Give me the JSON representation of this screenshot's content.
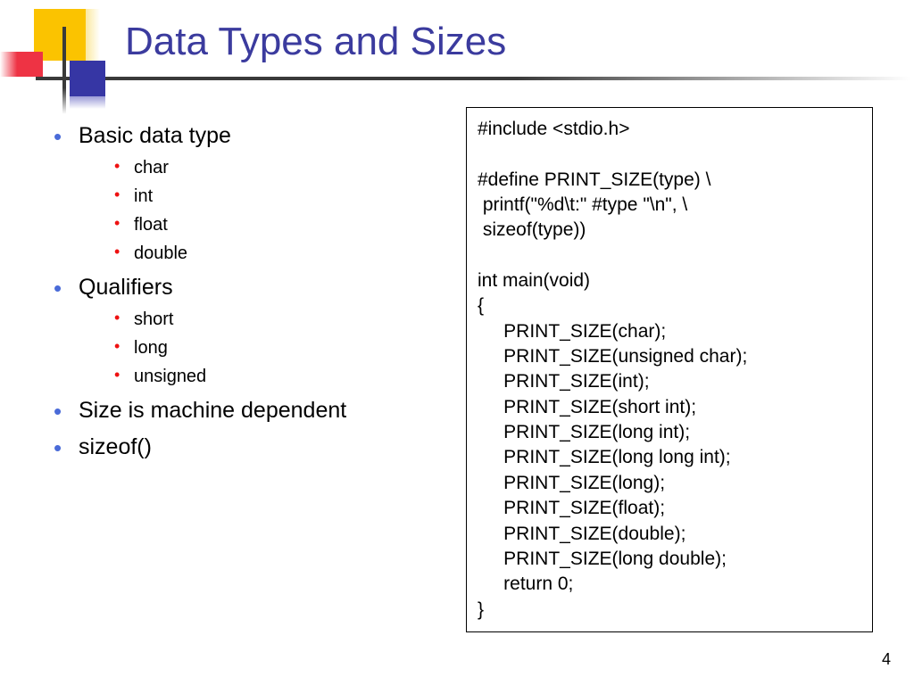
{
  "title": "Data Types and Sizes",
  "bullets": {
    "b1": {
      "label": "Basic data type",
      "sub": [
        "char",
        "int",
        "float",
        "double"
      ]
    },
    "b2": {
      "label": "Qualifiers",
      "sub": [
        "short",
        "long",
        "unsigned"
      ]
    },
    "b3": {
      "label": "Size is machine dependent"
    },
    "b4": {
      "label": "sizeof()"
    }
  },
  "code": "#include <stdio.h>\n\n#define PRINT_SIZE(type) \\\n printf(\"%d\\t:\" #type \"\\n\", \\\n sizeof(type))\n\nint main(void)\n{\n     PRINT_SIZE(char);\n     PRINT_SIZE(unsigned char);\n     PRINT_SIZE(int);\n     PRINT_SIZE(short int);\n     PRINT_SIZE(long int);\n     PRINT_SIZE(long long int);\n     PRINT_SIZE(long);\n     PRINT_SIZE(float);\n     PRINT_SIZE(double);\n     PRINT_SIZE(long double);\n     return 0;\n}",
  "page_number": "4"
}
